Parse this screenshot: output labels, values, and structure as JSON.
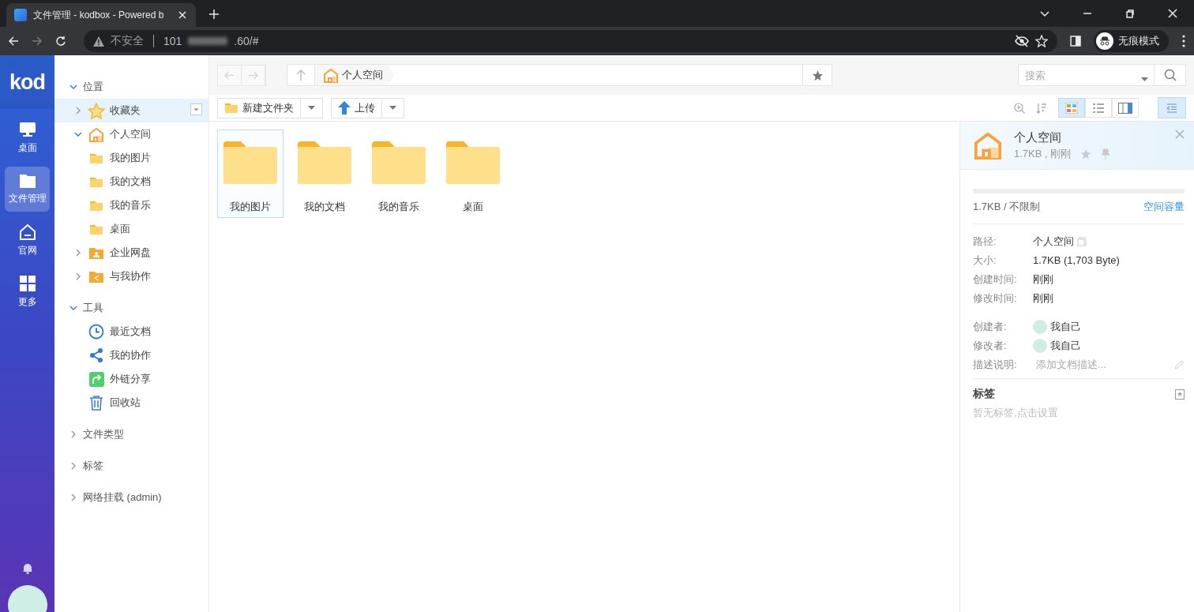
{
  "browser": {
    "tab_title": "文件管理 - kodbox - Powered b",
    "security": "不安全",
    "url_start": "101",
    "url_end": ".60/#",
    "profile": "无痕模式"
  },
  "rail": {
    "logo": "kod",
    "items": [
      {
        "label": "桌面",
        "kind": "desktop",
        "selected": false
      },
      {
        "label": "文件管理",
        "kind": "folder",
        "selected": true
      },
      {
        "label": "官网",
        "kind": "home",
        "selected": false
      },
      {
        "label": "更多",
        "kind": "grid",
        "selected": false
      }
    ]
  },
  "tree": {
    "sections": [
      {
        "label": "位置",
        "expanded": true,
        "selected": false,
        "children": [
          {
            "label": "收藏夹",
            "kind": "star",
            "expanded": false,
            "selected": true
          },
          {
            "label": "个人空间",
            "kind": "home",
            "expanded": true,
            "selected": false,
            "children": [
              {
                "label": "我的图片",
                "kind": "folder",
                "selected": false
              },
              {
                "label": "我的文档",
                "kind": "folder",
                "selected": false
              },
              {
                "label": "我的音乐",
                "kind": "folder",
                "selected": false
              },
              {
                "label": "桌面",
                "kind": "folder",
                "selected": false
              }
            ]
          },
          {
            "label": "企业网盘",
            "kind": "group-folder",
            "expanded": false,
            "selected": false
          },
          {
            "label": "与我协作",
            "kind": "share-folder",
            "expanded": false,
            "selected": false
          }
        ]
      },
      {
        "label": "工具",
        "expanded": true,
        "selected": false,
        "children": [
          {
            "label": "最近文档",
            "kind": "clock",
            "selected": false
          },
          {
            "label": "我的协作",
            "kind": "share",
            "selected": false
          },
          {
            "label": "外链分享",
            "kind": "link-share",
            "selected": false
          },
          {
            "label": "回收站",
            "kind": "trash",
            "selected": false
          }
        ]
      },
      {
        "label": "文件类型",
        "expanded": false,
        "selected": false
      },
      {
        "label": "标签",
        "expanded": false,
        "selected": false
      },
      {
        "label": "网络挂载 (admin)",
        "expanded": false,
        "selected": false
      }
    ]
  },
  "toolbar": {
    "breadcrumb": [
      "个人空间"
    ],
    "search": {
      "placeholder": "搜索"
    },
    "new_folder": "新建文件夹",
    "upload": "上传",
    "view_modes": [
      {
        "kind": "icon",
        "selected": true
      },
      {
        "kind": "list",
        "selected": false
      },
      {
        "kind": "split",
        "selected": false
      }
    ],
    "info_toggle": {
      "on": true
    }
  },
  "files": [
    {
      "name": "我的图片",
      "selected": true
    },
    {
      "name": "我的文档",
      "selected": false
    },
    {
      "name": "我的音乐",
      "selected": false
    },
    {
      "name": "桌面",
      "selected": false
    }
  ],
  "info": {
    "title": "个人空间",
    "subtitle": "1.7KB , 刚刚",
    "level": 0,
    "usage": "1.7KB / 不限制",
    "capacity_link": "空间容量",
    "properties": [
      {
        "kind": "path",
        "label": "路径:",
        "value": "个人空间"
      },
      {
        "kind": "text",
        "label": "大小:",
        "value": "1.7KB (1,703 Byte)"
      },
      {
        "kind": "text",
        "label": "创建时间:",
        "value": "刚刚"
      },
      {
        "kind": "text",
        "label": "修改时间:",
        "value": "刚刚"
      },
      {
        "kind": "user",
        "label": "创建者:",
        "value": "我自己"
      },
      {
        "kind": "user",
        "label": "修改者:",
        "value": "我自己"
      },
      {
        "kind": "input",
        "label": "描述说明:",
        "placeholder": "添加文档描述..."
      }
    ],
    "tags_title": "标签",
    "tags_hint": "暂无标签,点击设置"
  }
}
